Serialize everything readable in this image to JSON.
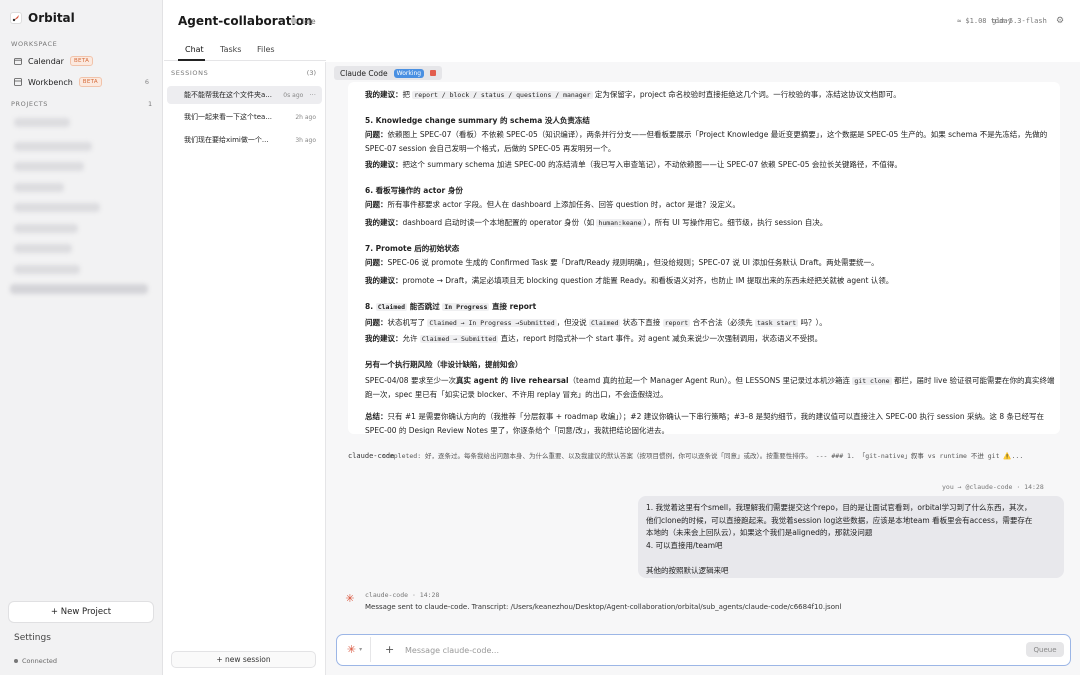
{
  "app": {
    "name": "Orbital"
  },
  "sidebar": {
    "workspace_label": "WORKSPACE",
    "items": [
      {
        "label": "Calendar",
        "badge": "BETA",
        "count": ""
      },
      {
        "label": "Workbench",
        "badge": "BETA",
        "count": "6"
      }
    ],
    "projects_label": "PROJECTS",
    "projects_count": "1",
    "new_project": "+ New Project",
    "settings": "Settings",
    "connection": "Connected"
  },
  "header": {
    "title": "Agent-collaboration",
    "status": "Idle",
    "cost": "≈ $1.08 today",
    "model": "glm-5.3-flash"
  },
  "tabs": [
    {
      "label": "Chat",
      "active": true
    },
    {
      "label": "Tasks",
      "active": false
    },
    {
      "label": "Files",
      "active": false
    }
  ],
  "sessions": {
    "label": "SESSIONS",
    "count": "(3)",
    "items": [
      {
        "title": "能不能帮我在这个文件夹a...",
        "ago": "0s ago"
      },
      {
        "title": "我们一起来看一下这个tea...",
        "ago": "2h ago"
      },
      {
        "title": "我们现在要给ximi做一个...",
        "ago": "3h ago"
      }
    ],
    "new_session": "+ new session"
  },
  "agent_tab": {
    "name": "Claude Code",
    "state": "Working"
  },
  "message": {
    "p1": {
      "lead": "我的建议：",
      "pre": "把 ",
      "code": "report / block / status / questions / manager",
      "post": " 定为保留字，project 命名校验时直接拒绝这几个词。一行校验的事，冻结这协议文档即可。"
    },
    "s5": {
      "title": "5. Knowledge change summary 的 schema 没人负责冻结",
      "q_lead": "问题：",
      "q": "依赖图上 SPEC-07（看板）不依赖 SPEC-05（知识编译），两条并行分支——但看板要展示「Project Knowledge 最近变更摘要」，这个数据是 SPEC-05 生产的。如果 schema 不是先冻结，先做的 SPEC-07 session 会自己发明一个格式，后做的 SPEC-05 再发明另一个。",
      "a_lead": "我的建议：",
      "a": "把这个 summary schema 加进 SPEC-00 的冻结清单（我已写入审查笔记），不动依赖图——让 SPEC-07 依赖 SPEC-05 会拉长关键路径，不值得。"
    },
    "s6": {
      "title": "6. 看板写操作的 actor 身份",
      "q_lead": "问题：",
      "q": "所有事件都要求 actor 字段。但人在 dashboard 上添加任务、回答 question 时，actor 是谁？没定义。",
      "a_lead": "我的建议：",
      "a_pre": "dashboard 启动时读一个本地配置的 operator 身份（如 ",
      "a_code": "human:keane",
      "a_post": "），所有 UI 写操作用它。细节级，执行 session 自决。"
    },
    "s7": {
      "title": "7. Promote 后的初始状态",
      "q_lead": "问题：",
      "q": "SPEC-06 说 promote 生成的 Confirmed Task 要「Draft/Ready 规则明确」，但没给规则；SPEC-07 说 UI 添加任务默认 Draft。两处需要统一。",
      "a_lead": "我的建议：",
      "a": "promote → Draft，满足必填项且无 blocking question 才能置 Ready。和看板语义对齐，也防止 IM 提取出来的东西未经把关就被 agent 认领。"
    },
    "s8": {
      "t_pre": "8. ",
      "t_code1": "Claimed",
      "t_mid": " 能否跳过 ",
      "t_code2": "In Progress",
      "t_post": " 直接 report",
      "q_lead": "问题：",
      "q_pre": "状态机写了 ",
      "q_code1": "Claimed → In Progress →Submitted",
      "q_mid": "，但没说 ",
      "q_code2": "Claimed",
      "q_mid2": " 状态下直接 ",
      "q_code3": "report",
      "q_mid3": " 合不合法（必须先 ",
      "q_code4": "task start",
      "q_post": " 吗？）。",
      "a_lead": "我的建议：",
      "a_pre": "允许 ",
      "a_code": "Claimed → Submitted",
      "a_post": " 直达，report 时隐式补一个 start 事件。对 agent 减负来说少一次强制调用，状态语义不受损。"
    },
    "extra": {
      "title": "另有一个执行期风险（非设计缺陷，提前知会）",
      "text_pre": "SPEC-04/08 要求至少一次",
      "text_bold": "真实 agent 的 live rehearsal",
      "text_mid": "（teamd 真的拉起一个 Manager Agent Run）。但 LESSONS 里记录过本机沙箱连 ",
      "text_code": "git clone",
      "text_post": " 都拦，届时 live 验证很可能需要在你的真实终端跑一次，spec 里已有「如实记录 blocker、不许用 replay 冒充」的出口，不会造假绕过。"
    },
    "summary": {
      "lead": "总结：",
      "text": "只有 #1 是需要你确认方向的（我推荐「分层叙事 + roadmap 收编」）；#2 建议你确认一下串行策略；#3–8 是契约细节，我的建议值可以直接注入 SPEC-00 执行 session 采纳。这 8 条已经写在 SPEC-00 的 Design Review Notes 里了，你逐条给个「同意/改」，我就把结论固化进去。"
    }
  },
  "completed": {
    "who": "claude-code",
    "text": "completed: 好，逐条过。每条我给出问题本身、为什么重要、以及我建议的默认答案（按项目惯例，你可以逐条说「同意」或改）。按重要性排序。 --- ### 1. 「git-native」叙事 vs runtime 不进 git ⚠️..."
  },
  "you": {
    "meta": "you → @claude-code · 14:28",
    "lines": [
      "1. 我觉着这里有个smell，我理解我们需要提交这个repo，目的是让面试官看到，orbital学习到了什么东西，其次，",
      "他们clone的时候，可以直接跑起来。我觉着session log这些数据，应该是本地team 看板里会有access，需要存在",
      "本地的（未来会上回队云），如果这个我们是aligned的，那就没问题",
      "4. 可以直接用/team吧",
      "",
      "其他的按照默认逻辑来吧"
    ]
  },
  "reply": {
    "meta": "claude-code · 14:28",
    "text": "Message sent to claude-code. Transcript: /Users/keanezhou/Desktop/Agent-collaboration/orbital/sub_agents/claude-code/c6684f10.jsonl"
  },
  "composer": {
    "placeholder": "Message claude-code...",
    "queue": "Queue"
  },
  "colors": {
    "accent": "#4a90e2",
    "claude": "#d9533a",
    "beta": "#d46b3a",
    "stop": "#e25d4d"
  }
}
